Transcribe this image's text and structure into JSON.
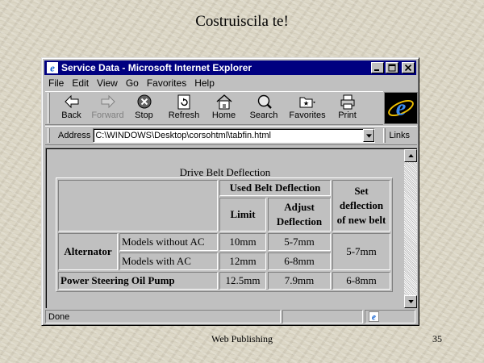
{
  "slide": {
    "title": "Costruiscila te!",
    "footer_center": "Web Publishing",
    "page_number": "35"
  },
  "window": {
    "title": "Service Data - Microsoft Internet Explorer",
    "minimize": "_",
    "maximize": "□",
    "close": "×"
  },
  "menu": [
    "File",
    "Edit",
    "View",
    "Go",
    "Favorites",
    "Help"
  ],
  "toolbar": {
    "back": "Back",
    "forward": "Forward",
    "stop": "Stop",
    "refresh": "Refresh",
    "home": "Home",
    "search": "Search",
    "favorites": "Favorites",
    "print": "Print"
  },
  "address": {
    "label": "Address",
    "value": "C:\\WINDOWS\\Desktop\\corsohtml\\tabfin.html",
    "links": "Links"
  },
  "page": {
    "caption": "Drive Belt Deflection",
    "table": {
      "used_belt_deflection": "Used Belt Deflection",
      "set_deflection": "Set deflection of new belt",
      "limit": "Limit",
      "adjust_deflection": "Adjust Deflection",
      "alternator": "Alternator",
      "rows": [
        {
          "label": "Models without AC",
          "limit": "10mm",
          "adjust": "5-7mm"
        },
        {
          "label": "Models with AC",
          "limit": "12mm",
          "adjust": "6-8mm"
        }
      ],
      "alternator_set": "5-7mm",
      "power_steering": {
        "label": "Power Steering Oil Pump",
        "limit": "12.5mm",
        "adjust": "7.9mm",
        "set": "6-8mm"
      }
    }
  },
  "status": {
    "text": "Done"
  },
  "colors": {
    "titlebar": "#000080",
    "chrome": "#c0c0c0"
  }
}
